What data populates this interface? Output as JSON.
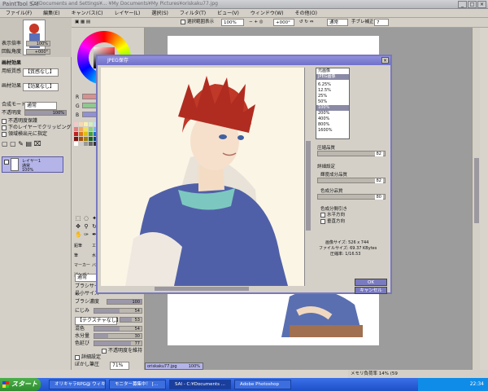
{
  "app": {
    "logo": "PaintTool SAI",
    "title_path": "C:¥Documents and Settings¥... ¥My Documents¥My Pictures¥oriskaku77.jpg"
  },
  "menu": [
    "ファイル(F)",
    "編集(E)",
    "キャンバス(C)",
    "レイヤー(L)",
    "選択(S)",
    "フィルタ(T)",
    "ビュー(V)",
    "ウィンドウ(W)",
    "その他(O)"
  ],
  "toolbar": {
    "antialias_label": "選択範囲表示",
    "zoom_value": "100%",
    "rotation_value": "+000°",
    "mode_value": "通常",
    "stabilizer_label": "手ブレ補正",
    "stabilizer_value": "7"
  },
  "left_panel": {
    "zoom_label": "表示倍率",
    "zoom_value": "100%",
    "rotate_label": "回転角度",
    "rotate_value": "+000°",
    "effect_heading": "画材効果",
    "texture_label": "用紙質感",
    "texture_value": "【質感なし】",
    "paint_label": "画材効果",
    "paint_value": "【効果なし】",
    "blend_label": "合成モード",
    "blend_value": "通常",
    "opacity_label": "不透明度",
    "opacity_value": "100%",
    "checks": [
      "不透明度保護",
      "下のレイヤーでクリッピング",
      "領域検出元に指定"
    ],
    "layer_name": "レイヤー1",
    "layer_mode": "通常",
    "layer_opacity": "100%"
  },
  "tool_panel": {
    "rgb": [
      "R",
      "G",
      "B"
    ],
    "brush_props": [
      {
        "label": "ブラシ濃度",
        "value": "100"
      },
      {
        "label": "にじみ",
        "value": "54"
      },
      {
        "label": "【テクスチャなし】",
        "value": "53"
      },
      {
        "label": "混色",
        "value": "54"
      },
      {
        "label": "水分量",
        "value": "30"
      },
      {
        "label": "色延び",
        "value": "77"
      }
    ],
    "keep_opacity": "不透明度を維持",
    "detail_heading": "詳細設定",
    "blur_pressure_label": "ぼかし筆圧",
    "blur_pressure_value": "71%",
    "size_label": "ブラシサイズ",
    "min_size_label": "最小サイズ",
    "mode": "通常",
    "tool_labels": [
      "鉛筆",
      "エア",
      "筆",
      "マーカー",
      "水彩",
      "バケツ",
      "消しゴム"
    ]
  },
  "dialog": {
    "title": "JPEG保存",
    "zoom_options": [
      "元画像",
      "JPEG画像",
      "6.25%",
      "12.5%",
      "25%",
      "50%",
      "100%",
      "200%",
      "400%",
      "800%",
      "1600%"
    ],
    "quality_heading": "圧縮品質",
    "quality_value": "82",
    "detail_heading": "詳細設定",
    "luma_label": "輝度成分品質",
    "luma_value": "82",
    "chroma_label": "色成分品質",
    "chroma_value": "80",
    "subsample_label": "色成分間引き",
    "horizontal_label": "水平方向",
    "vertical_label": "垂直方向",
    "image_size": "画像サイズ: 526 x 744",
    "file_size": "ファイルサイズ: 69.37 KBytes",
    "ratio": "圧縮率: 1/16.53",
    "ok_label": "OK",
    "cancel_label": "キャンセル"
  },
  "status": {
    "file_tab": "oriskaku77.jpg",
    "file_zoom": "100%",
    "memory": "メモリ負荷率 14% (59"
  },
  "taskbar": {
    "start": "スタート",
    "tasks": [
      "オリキャラRPG@ ウィキ...",
      "モニター募集中！ [...",
      "SAI - C:¥Documents ...",
      "Adobe Photoshop"
    ],
    "time": "22:34"
  }
}
